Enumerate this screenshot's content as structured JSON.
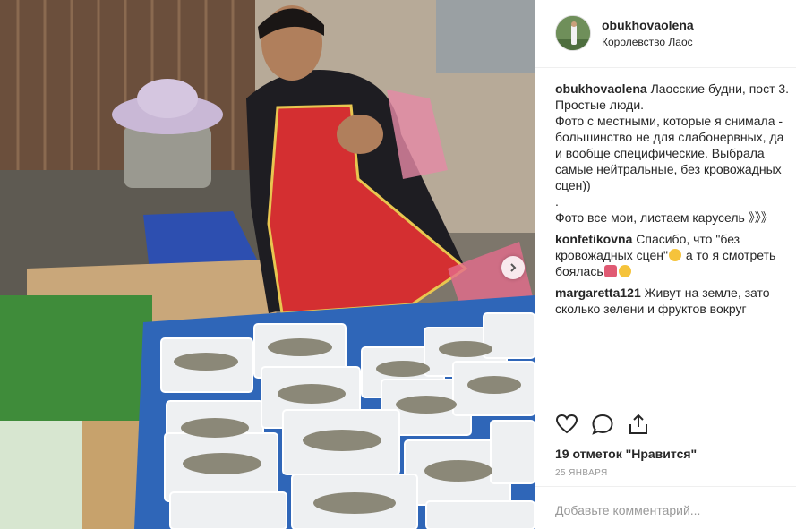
{
  "post": {
    "username": "obukhovaolena",
    "location": "Королевство Лаос"
  },
  "caption": {
    "username": "obukhovaolena",
    "line1": "Лаосские будни, пост 3.",
    "line2": "Простые люди.",
    "line3": "Фото с местными, которые я снимала - большинство не для слабонервных, да и вообще специфические. Выбрала самые нейтральные, без кровожадных сцен))",
    "line4": ".",
    "line5": "Фото все мои, листаем карусель 》》》"
  },
  "comments": [
    {
      "username": "konfetikovna",
      "text_a": "Спасибо, что \"без кровожадных сцен\"",
      "text_b": " а то я смотреть боялась"
    },
    {
      "username": "margaretta121",
      "text": "Живут на земле, зато сколько зелени и фруктов вокруг"
    }
  ],
  "icons": {
    "like": "heart-icon",
    "comment": "speech-bubble-icon",
    "share": "share-icon",
    "next": "chevron-right-icon",
    "emoji_grin": "grinning-face-emoji",
    "emoji_heart": "heart-emoji"
  },
  "likes_text": "19 отметок \"Нравится\"",
  "date_text": "25 ЯНВАРЯ",
  "add_comment_placeholder": "Добавьте комментарий..."
}
